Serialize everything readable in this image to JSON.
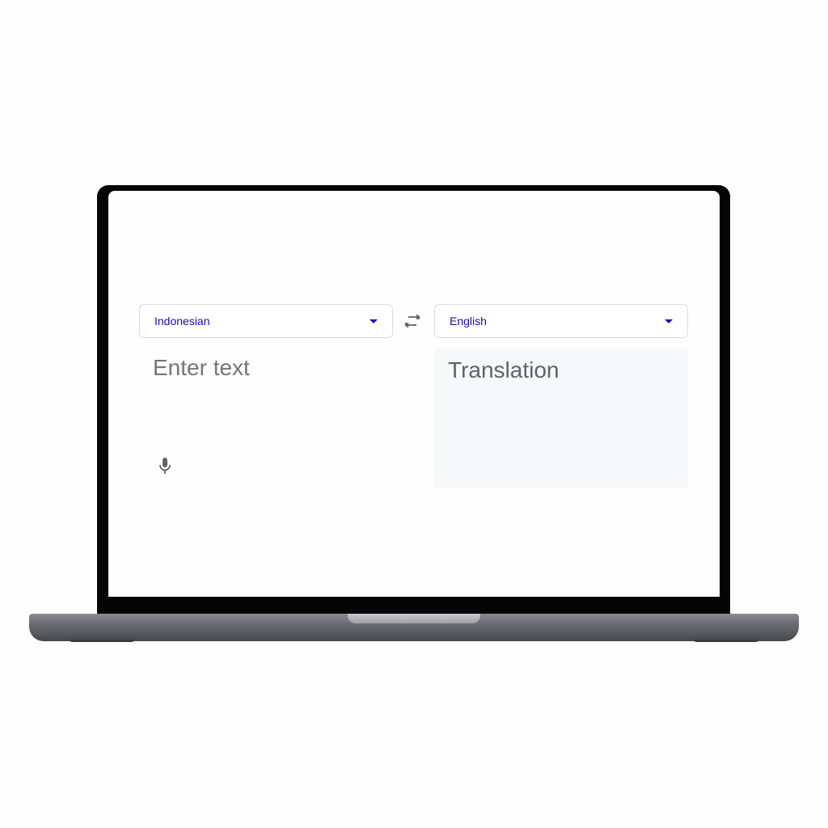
{
  "source_language": {
    "label": "Indonesian"
  },
  "target_language": {
    "label": "English"
  },
  "swap": {
    "icon": "swap-languages-icon"
  },
  "source": {
    "placeholder": "Enter text",
    "mic_icon": "microphone-icon"
  },
  "target": {
    "placeholder": "Translation"
  },
  "colors": {
    "link_blue": "#1a0dab",
    "border": "#dadce0",
    "translation_bg": "#f7f8fa",
    "bezel": "#050505"
  }
}
